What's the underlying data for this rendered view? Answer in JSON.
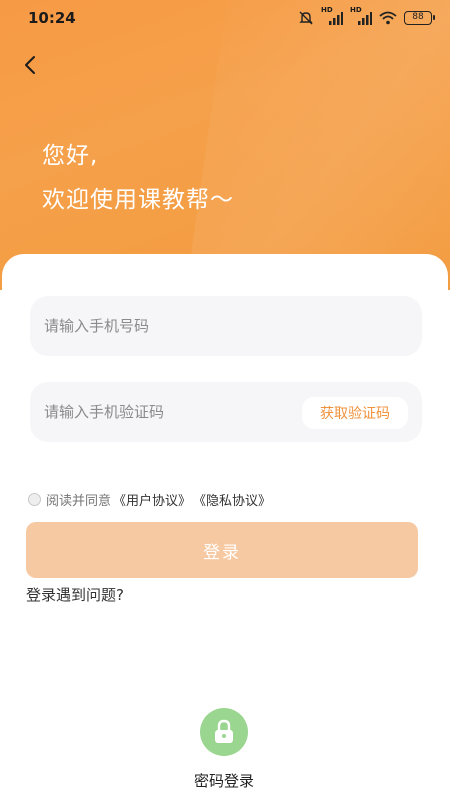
{
  "status_bar": {
    "time": "10:24",
    "battery": "88",
    "hd1": "HD",
    "hd2": "HD"
  },
  "header": {
    "greeting_line1": "您好,",
    "greeting_line2": "欢迎使用课教帮～"
  },
  "form": {
    "phone_placeholder": "请输入手机号码",
    "code_placeholder": "请输入手机验证码",
    "get_code_label": "获取验证码"
  },
  "agreement": {
    "prefix": "阅读并同意",
    "user_agreement": "《用户协议》",
    "privacy_agreement": "《隐私协议》"
  },
  "login_label": "登录",
  "help_label": "登录遇到问题?",
  "password_login_label": "密码登录",
  "colors": {
    "accent": "#f39a3d",
    "button_disabled": "#f7c9a2",
    "lock_icon_bg": "#9ad68f"
  }
}
